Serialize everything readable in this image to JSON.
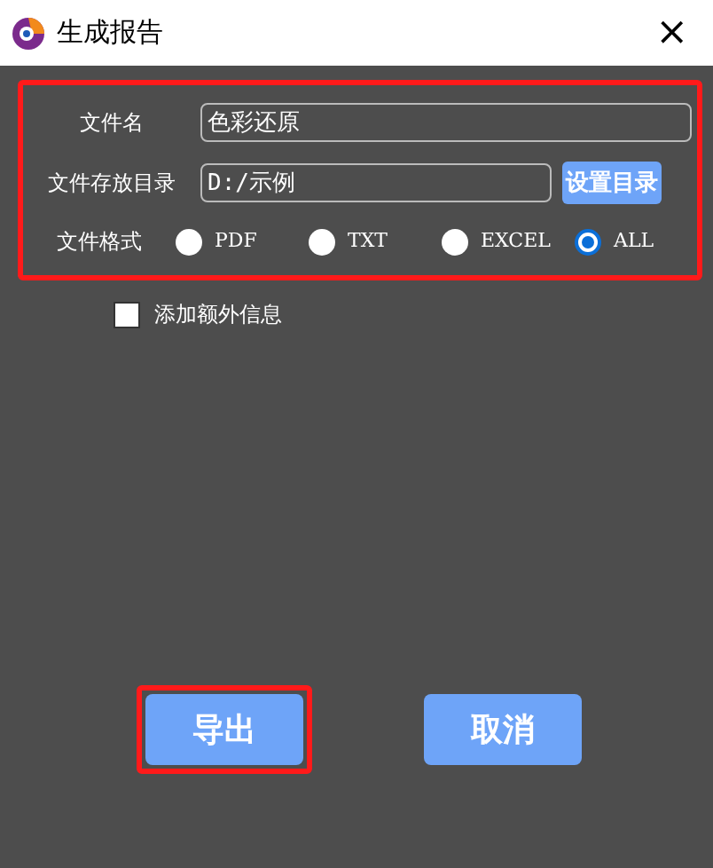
{
  "window": {
    "title": "生成报告",
    "close": "×"
  },
  "fields": [
    {
      "label": "文件名",
      "value": "色彩还原"
    },
    {
      "label": "文件存放目录",
      "value": "D:/示例",
      "button": "设置目录"
    }
  ],
  "format": {
    "label": "文件格式",
    "options": [
      {
        "label": "PDF",
        "selected": false
      },
      {
        "label": "TXT",
        "selected": false
      },
      {
        "label": "EXCEL",
        "selected": false
      },
      {
        "label": "ALL",
        "selected": true
      }
    ]
  },
  "extra_info": {
    "label": "添加额外信息",
    "checked": false
  },
  "buttons": [
    {
      "label": "导出",
      "highlighted": true
    },
    {
      "label": "取消",
      "highlighted": false
    }
  ]
}
